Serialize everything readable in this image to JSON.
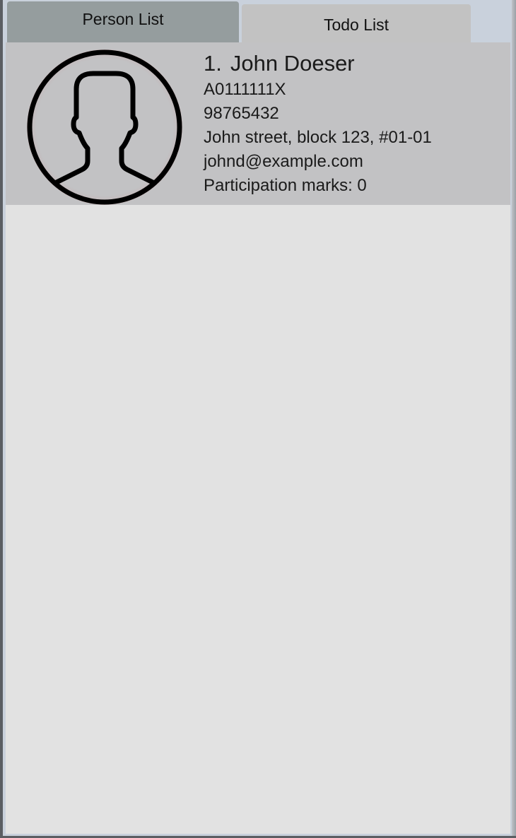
{
  "tabs": [
    {
      "label": "Person List",
      "selected": true
    },
    {
      "label": "Todo List",
      "selected": false
    }
  ],
  "person_list": {
    "items": [
      {
        "index": "1.",
        "name": "John Doeser",
        "matric": "A0111111X",
        "phone": "98765432",
        "address": "John street, block 123, #01-01",
        "email": "johnd@example.com",
        "participation": "Participation marks: 0",
        "avatar_icon": "person-silhouette-icon"
      }
    ]
  },
  "colors": {
    "selected_tab": "#959d9e",
    "unselected_tab": "#c2c2c2",
    "card_background": "#c2c2c4",
    "list_background": "#e2e2e2",
    "window_background": "#c9d1dc"
  }
}
